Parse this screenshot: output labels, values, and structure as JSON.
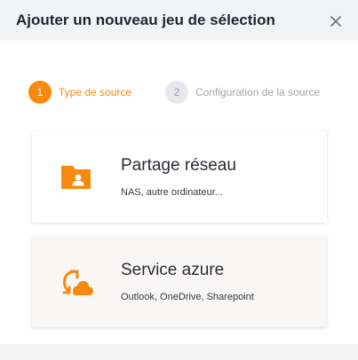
{
  "dialog": {
    "title": "Ajouter un nouveau jeu de sélection",
    "close_icon": "close-icon"
  },
  "steps": [
    {
      "number": "1",
      "label": "Type de source",
      "state": "active",
      "color": "#f7890f"
    },
    {
      "number": "2",
      "label": "Configuration de la source",
      "state": "inactive"
    }
  ],
  "options": [
    {
      "title": "Partage réseau",
      "description": "NAS, autre ordinateur...",
      "icon": "network-share-folder-icon"
    },
    {
      "title": "Service azure",
      "description": "Outlook, OneDrive, Sharepoint",
      "icon": "cloud-sync-icon"
    }
  ],
  "colors": {
    "accent": "#f7890f",
    "header_bg": "#f2f3f5"
  }
}
